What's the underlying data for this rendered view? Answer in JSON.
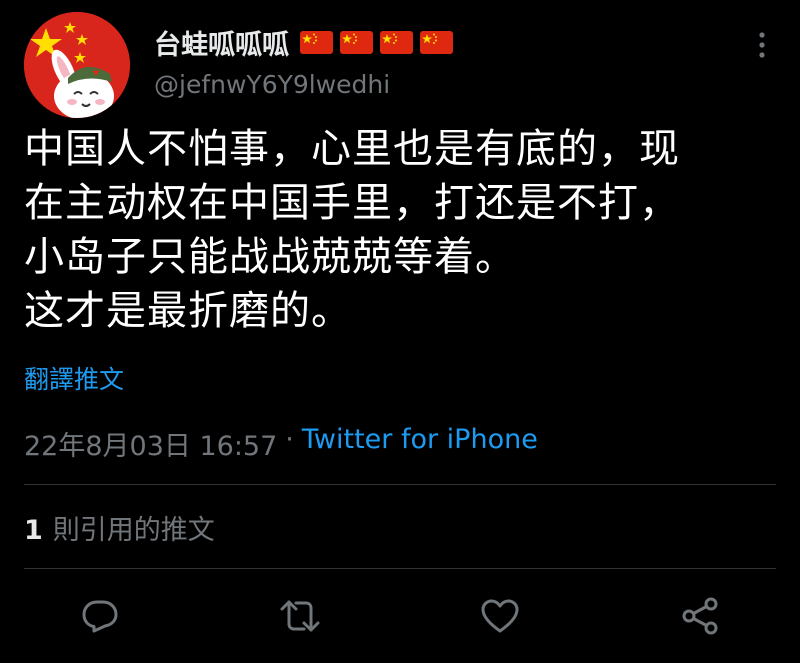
{
  "tweet": {
    "display_name": "台蛙呱呱呱",
    "handle": "@jefnwY6Y9lwedhi",
    "flag_count": 4,
    "text": "中国人不怕事，心里也是有底的，现\n在主动权在中国手里，打还是不打，\n小岛子只能战战兢兢等着。\n这才是最折磨的。",
    "translate_label": "翻譯推文",
    "date": "22年8月03日 16:57",
    "separator": "·",
    "source": "Twitter for iPhone",
    "quote_count": "1",
    "quote_label": "則引用的推文"
  },
  "icons": {
    "more": "more-vertical-icon",
    "reply": "reply-icon",
    "retweet": "retweet-icon",
    "like": "heart-icon",
    "share": "share-icon",
    "flag": "china-flag-icon"
  },
  "colors": {
    "background": "#000000",
    "text": "#ffffff",
    "secondary": "#71767b",
    "link": "#1d9bf0",
    "divider": "#2f3336",
    "flag_red": "#de2910",
    "flag_yellow": "#ffde00"
  }
}
